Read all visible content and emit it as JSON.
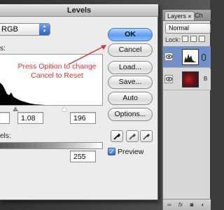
{
  "dialog": {
    "title": "Levels",
    "channel": "RGB",
    "input_label": "s:",
    "output_label": "els:",
    "input_values": {
      "black": "",
      "gamma": "1.08",
      "white": "196"
    },
    "output_values": {
      "black": "",
      "white": "255"
    },
    "buttons": {
      "ok": "OK",
      "cancel": "Cancel",
      "load": "Load...",
      "save": "Save...",
      "auto": "Auto",
      "options": "Options..."
    },
    "preview_label": "Preview",
    "preview_checked": true
  },
  "annotation": {
    "text_line1": "Press Opition to change",
    "text_line2": "Cancel to Reset",
    "color": "#e03030"
  },
  "layers_panel": {
    "tabs": [
      "Layers",
      "Ch"
    ],
    "blend_mode": "Normal",
    "lock_label": "Lock:",
    "layers": [
      {
        "name": "",
        "type": "levels-adjustment",
        "selected": true
      },
      {
        "name": "B",
        "type": "image",
        "selected": false
      }
    ],
    "footer_icons": [
      "link-icon",
      "fx-icon"
    ]
  },
  "icons": {
    "eyedroppers": [
      "black-eyedropper-icon",
      "gray-eyedropper-icon",
      "white-eyedropper-icon"
    ]
  },
  "colors": {
    "accent": "#5e9ef2",
    "annotation": "#e03030",
    "selected_layer": "#6f90c8"
  }
}
